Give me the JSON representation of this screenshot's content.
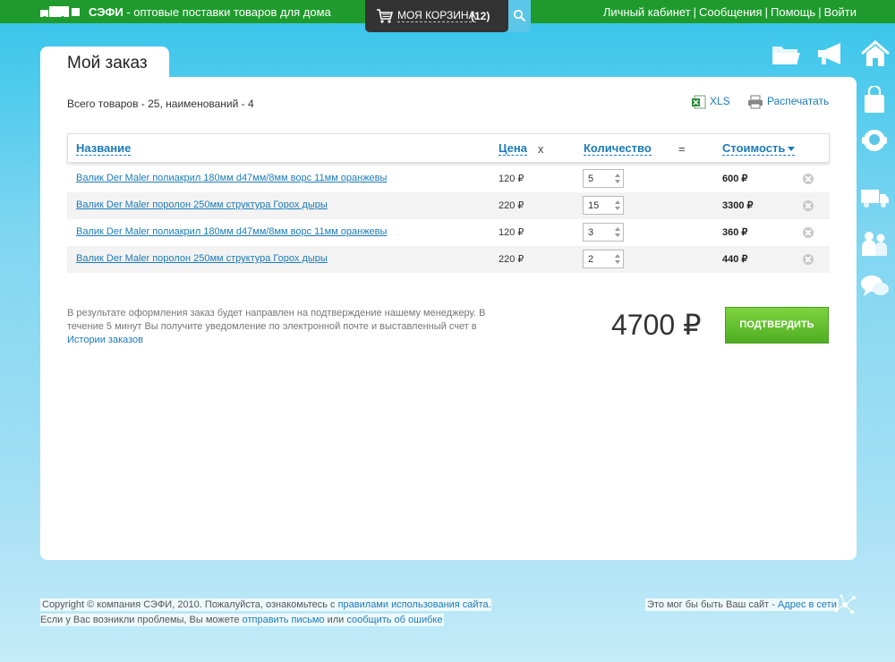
{
  "topbar": {
    "brand_name": "СЭФИ",
    "brand_tagline": " - оптовые поставки товаров для дома",
    "cart_label": "МОЯ КОРЗИНА",
    "cart_count": "(12)",
    "links": [
      "Личный кабинет",
      "Сообщения",
      "Помощь",
      "Войти"
    ],
    "separator": "|"
  },
  "page": {
    "title": "Мой заказ",
    "summary": "Всего товаров - 25, наименований - 4",
    "xls_label": "XLS",
    "print_label": "Распечатать"
  },
  "table": {
    "headers": {
      "name": "Название",
      "price": "Цена",
      "times": "x",
      "qty": "Количество",
      "equals": "=",
      "cost": "Стоимость"
    },
    "rows": [
      {
        "name": "Валик Der Maler полиакрил 180мм d47мм/8мм ворс 11мм оранжевы",
        "price": "120 ₽",
        "qty": "5",
        "cost": "600 ₽"
      },
      {
        "name": "Валик Der Maler поролон 250мм структура Горох дыры",
        "price": "220 ₽",
        "qty": "15",
        "cost": "3300 ₽"
      },
      {
        "name": "Валик Der Maler полиакрил 180мм d47мм/8мм ворс 11мм оранжевы",
        "price": "120 ₽",
        "qty": "3",
        "cost": "360 ₽"
      },
      {
        "name": "Валик Der Maler поролон 250мм структура Горох дыры",
        "price": "220 ₽",
        "qty": "2",
        "cost": "440 ₽"
      }
    ]
  },
  "order": {
    "note_text": "В результате оформления заказ будет направлен на подтверждение нашему менеджеру. В течение 5 минут Вы получите уведомление по электронной почте и выставленный счет в ",
    "note_link": "Истории заказов",
    "total": "4700 ₽",
    "confirm_label": "ПОДТВЕРДИТЬ"
  },
  "footer": {
    "copyright_pre": "Copyright © компания СЭФИ, 2010. Пожалуйста, ознакомьтесь с ",
    "rules_link": "правилами использования сайта",
    "copyright_mid": ". Если у Вас возникли проблемы, Вы можете ",
    "mail_link": "отправить письмо",
    "or_text": " или ",
    "report_link": "сообщить об ошибке",
    "site_text": "Это мог бы быть Ваш сайт - ",
    "site_link": "Адрес в сети"
  },
  "colors": {
    "topbar": "#1f9b2e",
    "link": "#1b7bb8",
    "confirm": "#5dbb2b",
    "sky": "#33c4ea"
  },
  "icons": [
    "truck-logo-icon",
    "cart-icon",
    "search-icon",
    "folder-icon",
    "megaphone-icon",
    "home-icon",
    "bag-icon",
    "support-icon",
    "delivery-truck-icon",
    "people-icon",
    "chat-icon",
    "xls-icon",
    "printer-icon",
    "remove-icon",
    "network-icon"
  ]
}
